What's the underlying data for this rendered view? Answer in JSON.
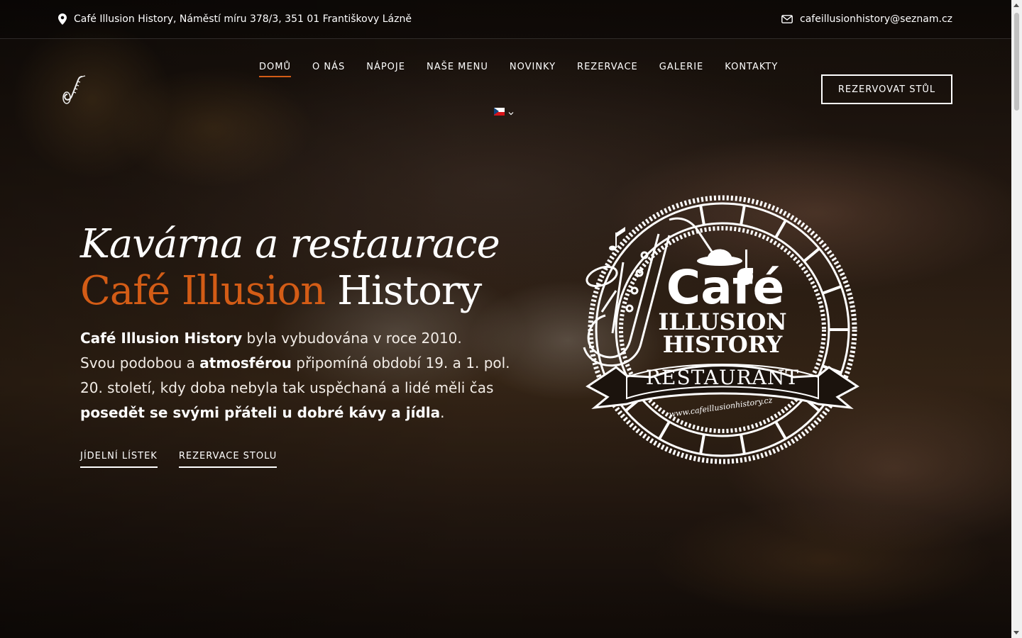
{
  "topbar": {
    "address": "Café Illusion History, Náměstí míru 378/3, 351 01 Františkovy Lázně",
    "email": "cafeillusionhistory@seznam.cz"
  },
  "nav": {
    "items": [
      {
        "label": "DOMŮ",
        "active": true
      },
      {
        "label": "O NÁS"
      },
      {
        "label": "NÁPOJE"
      },
      {
        "label": "NAŠE MENU"
      },
      {
        "label": "NOVINKY"
      },
      {
        "label": "REZERVACE"
      },
      {
        "label": "GALERIE"
      },
      {
        "label": "KONTAKTY"
      }
    ],
    "language": "cs",
    "cta": "REZERVOVAT STŮL"
  },
  "hero": {
    "title_line1": "Kavárna a restaurace",
    "title_accent": "Café Illusion",
    "title_rest": " History",
    "p_bold1": "Café Illusion History",
    "p_text1": " byla vybudována v roce 2010.",
    "p_text2": "Svou podobou a ",
    "p_bold2": "atmosférou",
    "p_text3": " připomíná období 19. a 1. pol. 20. století, kdy doba nebyla tak uspěchaná a lidé měli čas ",
    "p_bold3": "posedět se svými přáteli u dobré kávy a jídla",
    "p_text4": ".",
    "link1": "JÍDELNÍ LÍSTEK",
    "link2": "REZERVACE STOLU"
  },
  "logo": {
    "word1": "Café",
    "word2": "ILLUSION",
    "word3": "HISTORY",
    "banner": "RESTAURANT",
    "url": "www.cafeillusionhistory.cz"
  },
  "colors": {
    "accent": "#d35c16"
  }
}
